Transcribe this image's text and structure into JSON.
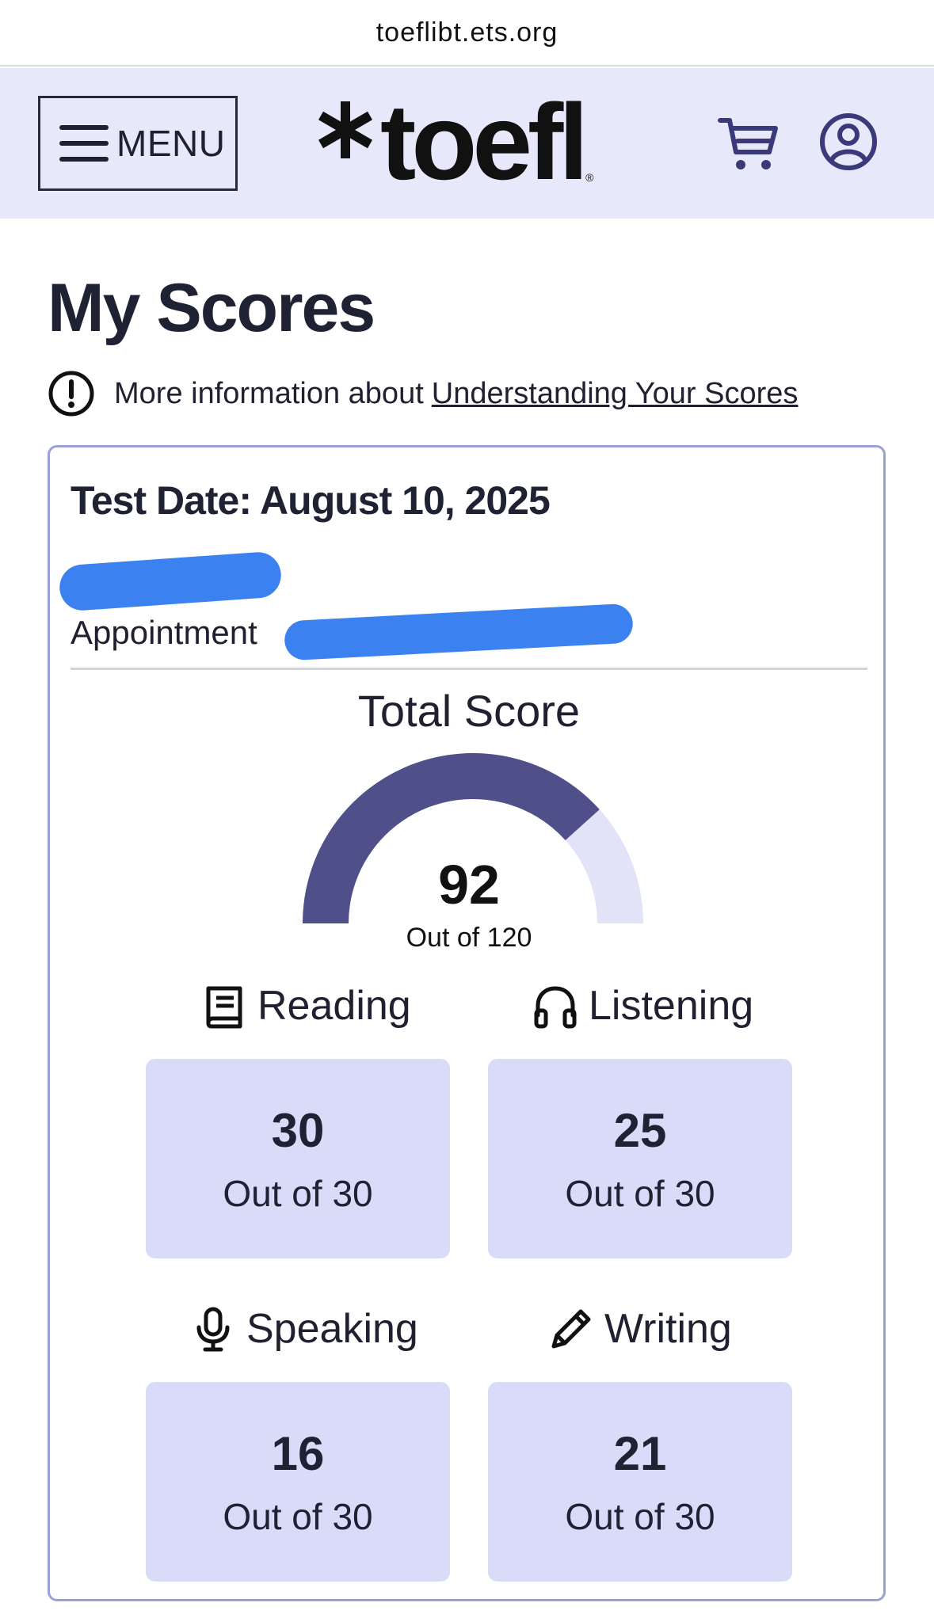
{
  "browser": {
    "url": "toeflibt.ets.org"
  },
  "header": {
    "menu_label": "MENU",
    "logo_text": "toefl",
    "logo_mark": "®",
    "icons": [
      "hamburger-icon",
      "cart-icon",
      "user-icon"
    ]
  },
  "page": {
    "title": "My Scores",
    "info_text": "More information about",
    "info_link": "Understanding Your Scores"
  },
  "card": {
    "test_date": "Test Date: August 10, 2025",
    "appointment_label": "Appointment",
    "total": {
      "label": "Total Score",
      "value": "92",
      "out_of": "Out of 120",
      "score": 92,
      "max": 120
    },
    "sections": [
      {
        "name": "Reading",
        "icon": "book-icon",
        "score": "30",
        "out_of": "Out of 30"
      },
      {
        "name": "Listening",
        "icon": "headphones-icon",
        "score": "25",
        "out_of": "Out of 30"
      },
      {
        "name": "Speaking",
        "icon": "microphone-icon",
        "score": "16",
        "out_of": "Out of 30"
      },
      {
        "name": "Writing",
        "icon": "pencil-icon",
        "score": "21",
        "out_of": "Out of 30"
      }
    ]
  },
  "colors": {
    "header_bg": "#e8e8fb",
    "gauge_fill": "#4f4f8a",
    "gauge_track": "#e3e3f8",
    "score_box_bg": "#d8dcf9",
    "card_border": "#9aa0d8",
    "icon_color": "#3a3a7a"
  }
}
